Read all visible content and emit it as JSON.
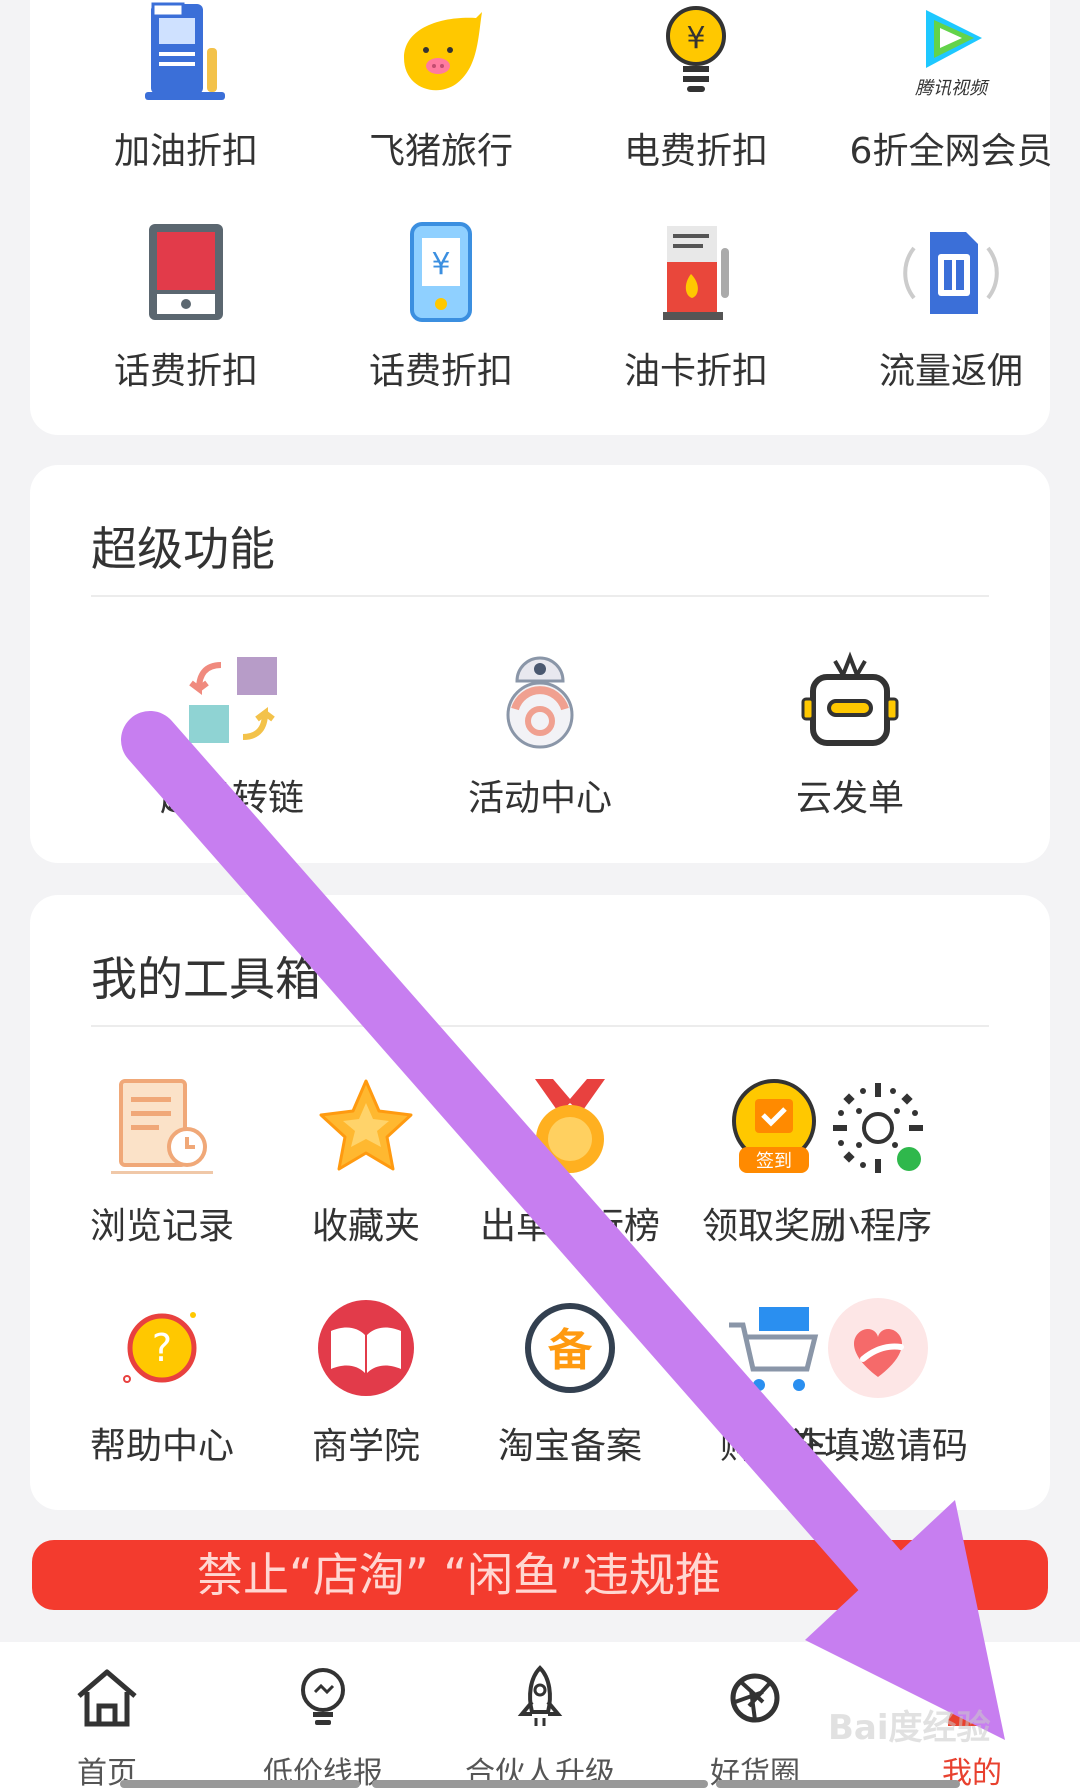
{
  "quick_services": [
    {
      "label": "加油折扣",
      "icon": "gas-station-icon"
    },
    {
      "label": "飞猪旅行",
      "icon": "fliggy-pig-icon"
    },
    {
      "label": "电费折扣",
      "icon": "lightbulb-yuan-icon"
    },
    {
      "label": "6折全网会员",
      "icon": "tencent-video-icon"
    },
    {
      "label": "话费折扣",
      "icon": "tablet-phone-icon"
    },
    {
      "label": "话费折扣",
      "icon": "phone-yuan-icon"
    },
    {
      "label": "油卡折扣",
      "icon": "fuel-card-icon"
    },
    {
      "label": "流量返佣",
      "icon": "sim-card-icon"
    }
  ],
  "super_features": {
    "title": "超级功能",
    "items": [
      {
        "label": "超级转链",
        "icon": "convert-link-icon"
      },
      {
        "label": "活动中心",
        "icon": "robot-ball-icon"
      },
      {
        "label": "云发单",
        "icon": "cloud-robot-icon"
      }
    ]
  },
  "toolbox": {
    "title": "我的工具箱",
    "items": [
      {
        "label": "浏览记录",
        "icon": "history-document-icon"
      },
      {
        "label": "收藏夹",
        "icon": "star-icon"
      },
      {
        "label": "出单排行榜",
        "icon": "medal-icon"
      },
      {
        "label": "领取奖励",
        "icon": "sign-in-calendar-icon",
        "badge": "签到"
      },
      {
        "label": "小程序",
        "icon": "mini-program-code-icon"
      },
      {
        "label": "帮助中心",
        "icon": "help-question-icon"
      },
      {
        "label": "商学院",
        "icon": "open-book-icon"
      },
      {
        "label": "淘宝备案",
        "icon": "record-badge-icon",
        "glyph": "备"
      },
      {
        "label": "购物车",
        "icon": "shopping-cart-icon"
      },
      {
        "label": "补填邀请码",
        "icon": "heart-hand-icon"
      }
    ]
  },
  "notice_banner": {
    "text": "禁止“店淘” “闲鱼”违规推"
  },
  "tabbar": {
    "items": [
      {
        "label": "首页",
        "icon": "home-icon",
        "active": false
      },
      {
        "label": "低价线报",
        "icon": "lightbulb-icon",
        "active": false
      },
      {
        "label": "合伙人升级",
        "icon": "rocket-icon",
        "active": false
      },
      {
        "label": "好货圈",
        "icon": "aperture-icon",
        "active": false
      },
      {
        "label": "我的",
        "icon": "profile-icon",
        "active": true
      }
    ]
  },
  "watermark": {
    "text": "Bai度经验"
  },
  "colors": {
    "accent": "#e8412f",
    "banner": "#f33b2e",
    "arrow": "#c77ef0"
  }
}
